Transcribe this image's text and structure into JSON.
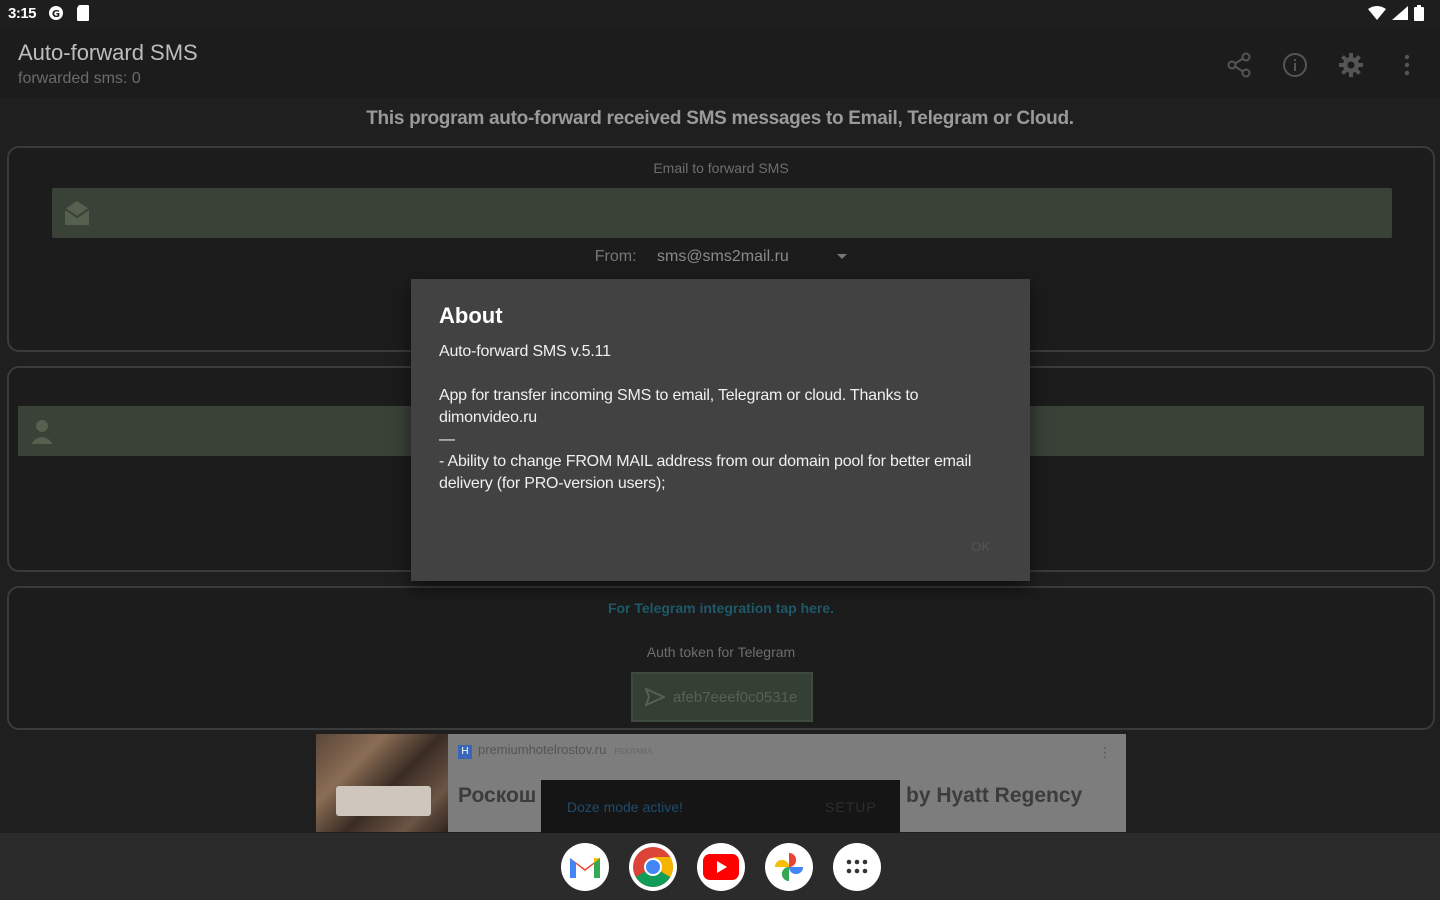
{
  "status_bar": {
    "time": "3:15"
  },
  "app_bar": {
    "title": "Auto-forward SMS",
    "subtitle": "forwarded sms:  0",
    "actions": [
      "share-icon",
      "info-icon",
      "settings-icon",
      "more-icon"
    ]
  },
  "main": {
    "intro": "This program auto-forward received SMS messages to Email, Telegram or Cloud.",
    "email_card": {
      "label": "Email to forward SMS",
      "from_label": "From:",
      "from_value": "sms@sms2mail.ru"
    },
    "telegram_card": {
      "link": "For Telegram integration tap here.",
      "token_label": "Auth token for Telegram",
      "token_value": "afeb7eeef0c0531e"
    }
  },
  "ad": {
    "domain": "premiumhotelrostov.ru",
    "tag": "РЕКЛАМА",
    "badge": "H",
    "headline_left": "Роскош",
    "headline_right": "by Hyatt Regency",
    "menu": "⋮"
  },
  "snackbar": {
    "message": "Doze mode active!",
    "action": "SETUP"
  },
  "dialog": {
    "title": "About",
    "body": "Auto-forward SMS v.5.11\n\nApp for transfer incoming SMS to email, Telegram or cloud. Thanks to dimonvideo.ru\n—\n - Ability to change FROM MAIL address from our domain pool for better email delivery (for PRO-version users);",
    "ok": "OK"
  },
  "dock": [
    "gmail-icon",
    "chrome-icon",
    "youtube-icon",
    "photos-icon",
    "apps-icon"
  ],
  "colors": {
    "accent_green_field": "#3a4238",
    "link": "#1f5a6a",
    "dialog_bg": "#424242"
  }
}
